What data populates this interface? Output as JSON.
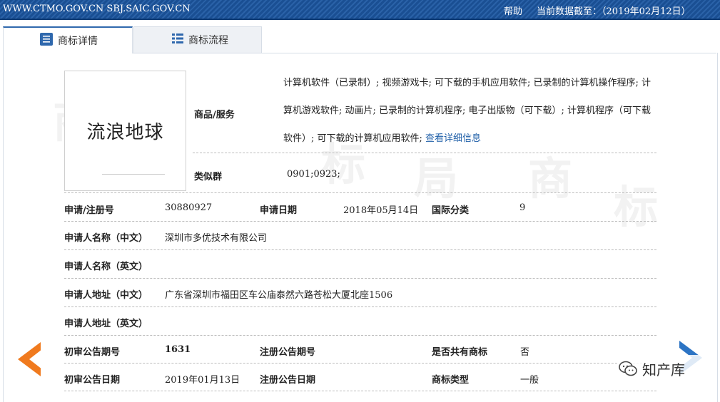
{
  "topbar": {
    "site": "WWW.CTMO.GOV.CN SBJ.SAIC.GOV.CN",
    "help": "帮助",
    "asof": "当前数据截至：（2019年02月12日）"
  },
  "tabs": [
    {
      "label": "商标详情",
      "icon": "document-icon"
    },
    {
      "label": "商标流程",
      "icon": "list-icon"
    }
  ],
  "watermark": [
    "商",
    "标",
    "局",
    "商",
    "标"
  ],
  "trademark": {
    "name": "流浪地球",
    "goods_label": "商品/服务",
    "goods_text": "计算机软件（已录制）; 视频游戏卡; 可下载的手机应用软件; 已录制的计算机操作程序; 计算机游戏软件; 动画片; 已录制的计算机程序; 电子出版物（可下载）; 计算机程序（可下载软件）; 可下载的计算机应用软件;",
    "goods_link": "查看详细信息",
    "similar_label": "类似群",
    "similar_value": "0901;0923;",
    "reg_no_label": "申请/注册号",
    "reg_no": "30880927",
    "apply_date_label": "申请日期",
    "apply_date": "2018年05月14日",
    "intl_class_label": "国际分类",
    "intl_class": "9",
    "applicant_cn_label": "申请人名称（中文）",
    "applicant_cn": "深圳市多优技术有限公司",
    "applicant_en_label": "申请人名称（英文）",
    "applicant_en": "",
    "address_cn_label": "申请人地址（中文）",
    "address_cn": "广东省深圳市福田区车公庙泰然六路苍松大厦北座1506",
    "address_en_label": "申请人地址（英文）",
    "address_en": "",
    "prelim_no_label": "初审公告期号",
    "prelim_no": "1631",
    "reg_pub_no_label": "注册公告期号",
    "reg_pub_no": "",
    "shared_label": "是否共有商标",
    "shared": "否",
    "prelim_date_label": "初审公告日期",
    "prelim_date": "2019年01月13日",
    "reg_pub_date_label": "注册公告日期",
    "reg_pub_date": "",
    "tm_type_label": "商标类型",
    "tm_type": "一般"
  },
  "brand": {
    "name": "知产库",
    "icon": "wechat-icon"
  },
  "colors": {
    "topbar": "#1a4f93",
    "link": "#1f5fa8",
    "arrow_left": "#f07a1e",
    "arrow_right": "#2c74c4"
  }
}
